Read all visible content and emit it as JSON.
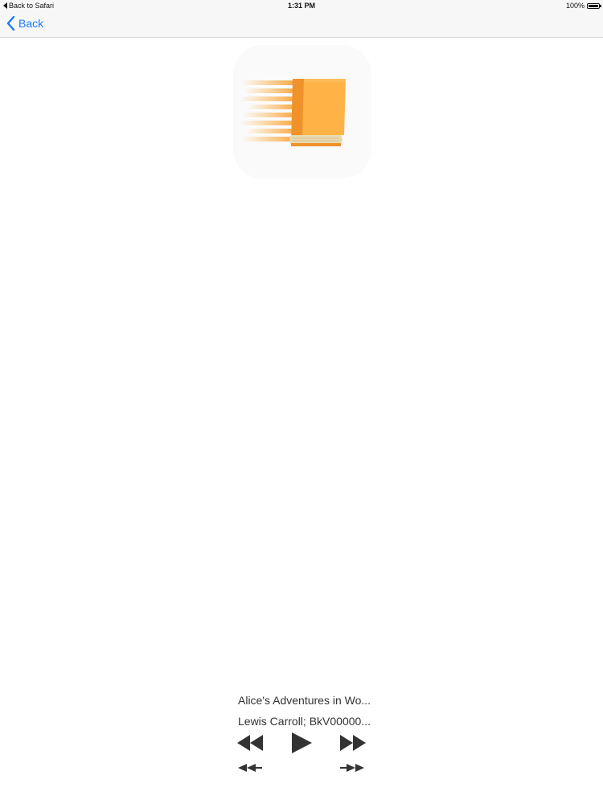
{
  "status_bar": {
    "back_to_app": "Back to Safari",
    "time": "1:31 PM",
    "battery": "100%"
  },
  "nav": {
    "back_label": "Back"
  },
  "player": {
    "title": "Alice's Adventures in Wo...",
    "artist": "Lewis Carroll; BkV00000..."
  },
  "colors": {
    "accent": "#1a7cf3",
    "book_orange": "#ffb347",
    "book_spine": "#f0922a",
    "pages": "#e9d9b0"
  },
  "icons": {
    "back": "chevron-left-icon",
    "rewind": "rewind-icon",
    "play": "play-icon",
    "fast_forward": "fast-forward-icon",
    "skip_back": "skip-back-icon",
    "skip_forward": "skip-forward-icon",
    "app": "book-icon"
  }
}
